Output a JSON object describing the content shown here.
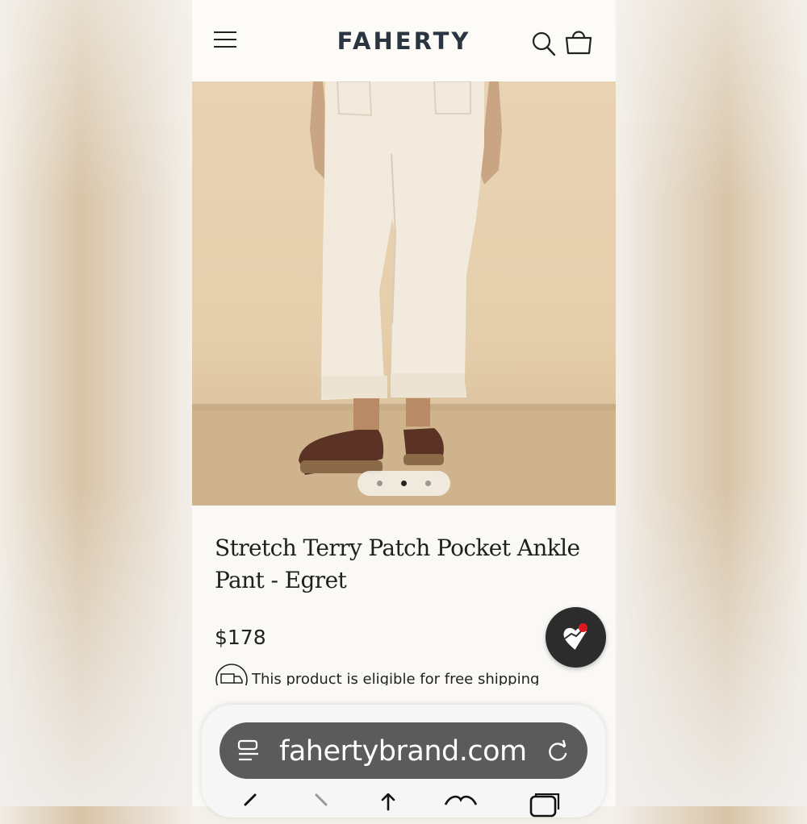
{
  "header": {
    "logo": "FAHERTY",
    "menu_icon": "hamburger-menu-icon",
    "search_icon": "search-icon",
    "bag_icon": "shopping-bag-icon"
  },
  "carousel": {
    "total": 3,
    "active_index": 2
  },
  "product": {
    "title": "Stretch Terry Patch Pocket Ankle Pant - Egret",
    "price": "$178",
    "shipping_note": "This product is eligible for free shipping",
    "shipping_icon": "truck-icon"
  },
  "favorite_button": {
    "icon": "heart-icon",
    "badge_color": "#e0181e"
  },
  "browser": {
    "url": "fahertybrand.com",
    "reader_icon": "reader-view-icon",
    "reload_icon": "reload-icon",
    "nav_icons": [
      "back-icon",
      "forward-icon",
      "share-icon",
      "bookmarks-icon",
      "tabs-icon"
    ]
  },
  "colors": {
    "logo": "#2b3542",
    "pill": "#5b5b5b",
    "fav_button": "#2c2c2c"
  }
}
